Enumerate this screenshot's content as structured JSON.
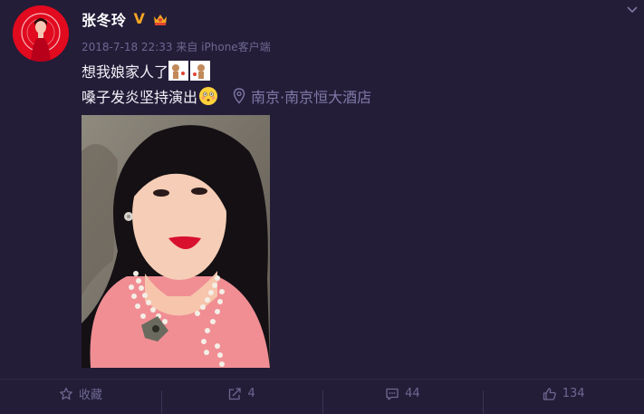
{
  "post": {
    "username": "张冬玲",
    "vip_badge": "V",
    "meta": {
      "time": "2018-7-18 22:33",
      "source_prefix": "来自",
      "source": "iPhone客户端"
    },
    "text_line1": "想我娘家人了",
    "text_line2": "嗓子发炎坚持演出",
    "location": "南京·南京恒大酒店"
  },
  "actions": {
    "favorite_label": "收藏",
    "repost_count": "4",
    "comment_count": "44",
    "like_count": "134"
  },
  "icons": {
    "menu": "chevron-down-icon",
    "vip": "verified-v-icon",
    "member": "crown-icon",
    "location": "location-pin-icon",
    "favorite": "star-icon",
    "repost": "share-arrow-icon",
    "comment": "comment-bubble-icon",
    "like": "thumbs-up-icon"
  },
  "colors": {
    "background": "#231d38",
    "username": "#ffffff",
    "vip": "#f5a623",
    "meta": "#6e6891",
    "location": "#7f79a6"
  }
}
